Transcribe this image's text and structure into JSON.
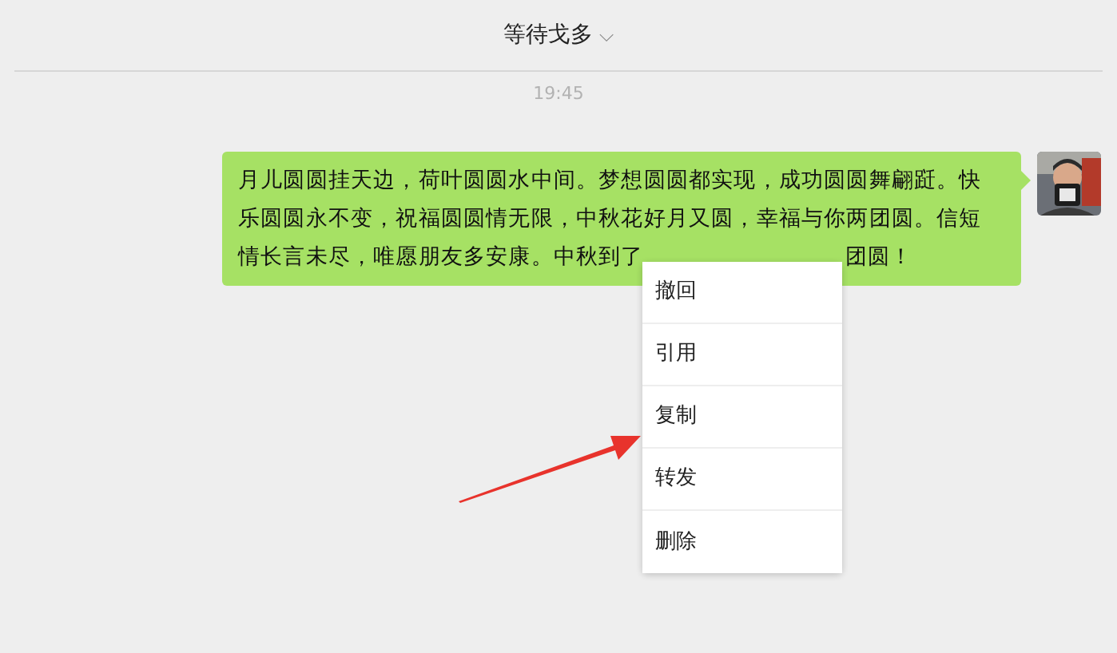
{
  "header": {
    "title": "等待戈多",
    "chevron": "⌵"
  },
  "time": "19:45",
  "message": {
    "lines": [
      {
        "parts": [
          "月儿圆圆挂天边，荷叶圆圆水中间。梦想圆圆都实现，成功圆圆舞翩跹。快"
        ]
      },
      {
        "parts": [
          "乐圆圆永不变，祝福圆圆情无限，中秋花好月又圆，幸福与你两团圆。信短"
        ]
      },
      {
        "parts": [
          "情长言未尽，唯愿朋友多安康。中秋到了",
          "团圆！"
        ]
      }
    ]
  },
  "context_menu": {
    "items": [
      {
        "label": "撤回"
      },
      {
        "label": "引用"
      },
      {
        "label": "复制"
      },
      {
        "label": "转发"
      },
      {
        "label": "删除"
      }
    ]
  }
}
